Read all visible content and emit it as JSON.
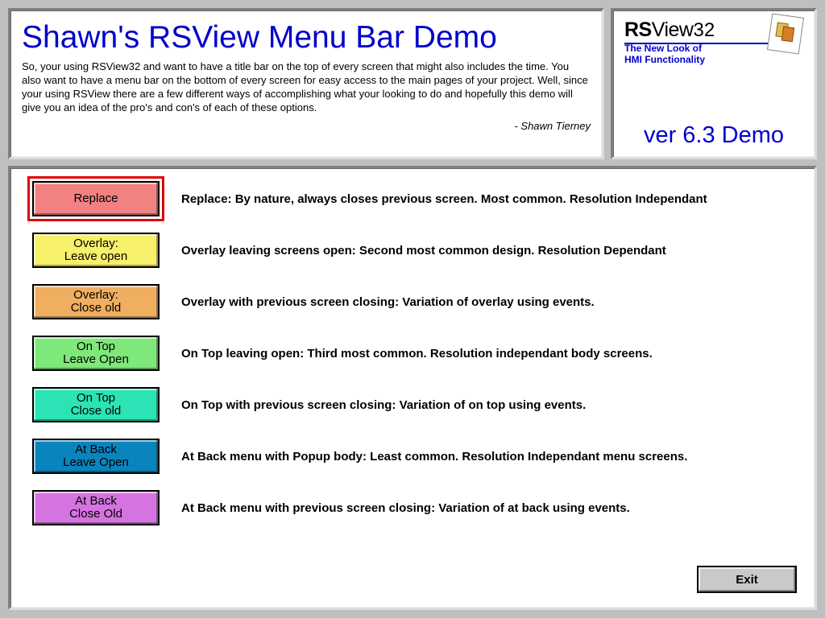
{
  "header": {
    "title": "Shawn's RSView Menu Bar Demo",
    "intro": "So, your using RSView32 and want to have a title bar on the top of every screen that might also includes the time. You also want to have a menu bar on the bottom of every screen for easy access to the main pages of your project. Well, since your using RSView there are a few different ways of accomplishing what your looking to do and hopefully this demo will give you an idea of the pro's and con's of each of these options.",
    "signoff": "- Shawn Tierney"
  },
  "logo": {
    "brand_rs": "RS",
    "brand_view": "View",
    "brand_32": "32",
    "sub_line1": "The New Look of",
    "sub_line2": "HMI Functionality",
    "version": "ver 6.3 Demo"
  },
  "options": [
    {
      "id": "replace",
      "label": "Replace",
      "desc": "Replace: By nature, always closes previous screen. Most common. Resolution Independant",
      "selected": true,
      "color_class": "btn-replace"
    },
    {
      "id": "overlay-open",
      "label": "Overlay:\nLeave open",
      "desc": "Overlay leaving screens open: Second most common design. Resolution Dependant",
      "selected": false,
      "color_class": "btn-overlay-open"
    },
    {
      "id": "overlay-close",
      "label": "Overlay:\nClose old",
      "desc": "Overlay with previous screen closing: Variation of overlay using events.",
      "selected": false,
      "color_class": "btn-overlay-close"
    },
    {
      "id": "ontop-open",
      "label": "On Top\nLeave Open",
      "desc": "On Top leaving open: Third most common.  Resolution independant body screens.",
      "selected": false,
      "color_class": "btn-ontop-open"
    },
    {
      "id": "ontop-close",
      "label": "On Top\nClose old",
      "desc": "On Top with previous screen closing: Variation of on top using events.",
      "selected": false,
      "color_class": "btn-ontop-close"
    },
    {
      "id": "atback-open",
      "label": "At Back\nLeave Open",
      "desc": "At Back menu with Popup body: Least common. Resolution Independant menu screens.",
      "selected": false,
      "color_class": "btn-atback-open"
    },
    {
      "id": "atback-close",
      "label": "At Back\nClose Old",
      "desc": "At Back menu with previous screen closing: Variation of at back using events.",
      "selected": false,
      "color_class": "btn-atback-close"
    }
  ],
  "exit_label": "Exit"
}
